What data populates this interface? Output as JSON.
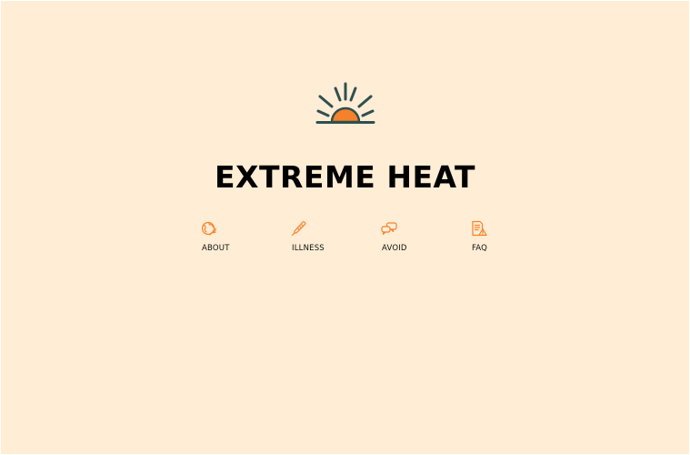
{
  "page": {
    "title": "EXTREME HEAT"
  },
  "logo": {
    "icon": "sunrise-icon",
    "sun_color": "#f5822a",
    "ray_color": "#2f4f4f"
  },
  "nav": {
    "items": [
      {
        "label": "ABOUT",
        "icon": "globe-heat-icon"
      },
      {
        "label": "ILLNESS",
        "icon": "thermometer-icon"
      },
      {
        "label": "AVOID",
        "icon": "speech-bubbles-icon"
      },
      {
        "label": "FAQ",
        "icon": "document-warning-icon"
      }
    ],
    "icon_color": "#f5822a"
  },
  "colors": {
    "background": "#ffedd5",
    "text": "#000000"
  }
}
